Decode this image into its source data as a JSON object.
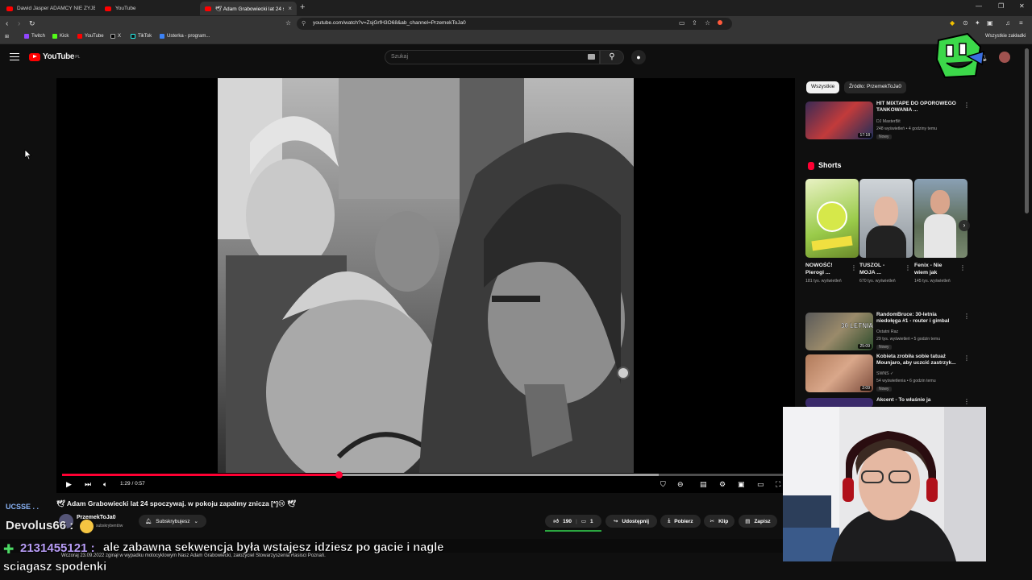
{
  "browser": {
    "tabs": [
      {
        "label": "Dawid Jasper ADAMCY NIE ŻYJE - Yo",
        "active": false
      },
      {
        "label": "YouTube",
        "active": false
      },
      {
        "label": "🕊 Adam Grabowiecki lat 24 spo",
        "active": true
      }
    ],
    "url": "youtube.com/watch?v=ZsjGrfH3O68&ab_channel=PrzemekToJa0",
    "bookmarks": [
      "Twitch",
      "Kick",
      "YouTube",
      "X",
      "TikTok",
      "Usterka - program..."
    ],
    "all_bookmarks_label": "Wszystkie zakładki"
  },
  "youtube": {
    "logo_text": "YouTube",
    "logo_region": "PL",
    "search_placeholder": "Szukaj"
  },
  "video": {
    "title": "🕊 Adam Grabowiecki lat 24 spoczywaj. w pokoju zapalmy znicza [*]😢 🕊",
    "time_current": "1:29",
    "time_total": "0:57",
    "time_display": "1:29 / 0:57",
    "progress_fraction": 0.38,
    "channel_name": "PrzemekToJa0",
    "channel_subs": "subskrybentów",
    "subscribe_label": "Subskrybujesz",
    "like_count": "190",
    "comment_count": "1",
    "share_label": "Udostępnij",
    "download_label": "Pobierz",
    "clip_label": "Klip",
    "save_label": "Zapisz",
    "description_preview": "Wczoraj 23.09.2022 zginął w wypadku motocyklowym Nasz Adam Grabowiecki, założyciel Stowarzyszenia Rasisci Poznań."
  },
  "sidebar": {
    "chips": [
      "Wszystkie",
      "Źródło: PrzemekToJa0"
    ],
    "videos": [
      {
        "title": "HIT MIXTAPE DO OPOROWEGO TANKOWANIA ...",
        "channel": "DJ MasterBit",
        "meta": "248 wyświetleń • 4 godziny temu",
        "badge": "Nowy",
        "duration": "17:18"
      },
      {
        "title": "RandomBruce: 30-letnia niedołęga #1 - router i gimbal",
        "channel": "Ostatni Raz",
        "meta": "29 tys. wyświetleń • 5 godzin temu",
        "badge": "Nowy",
        "duration": "25:09"
      },
      {
        "title": "Kobieta zrobiła sobie tatuaż Mounjaro, aby uczcić zastrzyk...",
        "channel": "SWNS ✓",
        "meta": "54 wyświetlenia • 6 godzin temu",
        "badge": "Nowy",
        "duration": "2:09"
      },
      {
        "title": "Akcent - To właśnie ja",
        "channel": "",
        "meta": "",
        "badge": "",
        "duration": ""
      }
    ],
    "shorts_heading": "Shorts",
    "shorts": [
      {
        "title": "NOWOŚĆ! Pierogi ...",
        "views": "181 tys. wyświetleń"
      },
      {
        "title": "TUSZOL - MOJA ...",
        "views": "670 tys. wyświetleń"
      },
      {
        "title": "Fenix - Nie wiem jak",
        "views": "145 tys. wyświetleń"
      }
    ]
  },
  "stream_overlay": {
    "chat_user_1": "Devolus66 :",
    "chat_user_2": "2131455121 :",
    "chat_message": "ale zabawna sekwencja była wstajesz idziesz po gacie i nagle",
    "chat_message_cont": "sciagasz spodenki",
    "ghost_line": "UCSSE . ."
  },
  "colors": {
    "accent_red": "#ff0033",
    "background": "#0f0f0f",
    "like_green": "#2ba640",
    "chat_purple": "#b79cf5"
  }
}
